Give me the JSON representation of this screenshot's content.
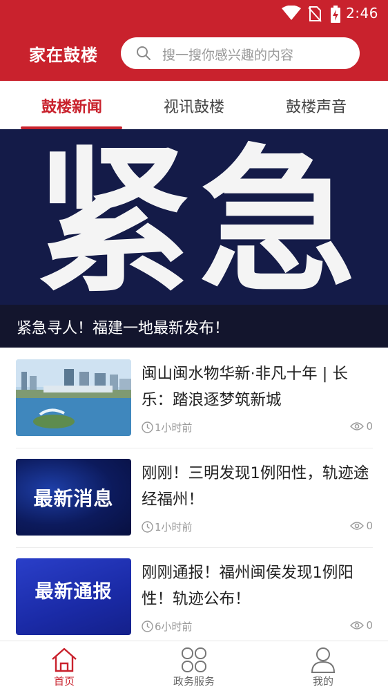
{
  "status_bar": {
    "time": "2:46",
    "icons": [
      "wifi-icon",
      "no-sim-icon",
      "battery-charging-icon"
    ]
  },
  "header": {
    "title": "家在鼓楼",
    "search_placeholder": "搜一搜你感兴趣的内容"
  },
  "tabs": [
    {
      "label": "鼓楼新闻",
      "active": true
    },
    {
      "label": "视讯鼓楼",
      "active": false
    },
    {
      "label": "鼓楼声音",
      "active": false
    }
  ],
  "banner": {
    "image_text": "紧急",
    "caption": "紧急寻人！福建一地最新发布！"
  },
  "news": [
    {
      "title": "闽山闽水物华新·非凡十年 | 长乐：踏浪逐梦筑新城",
      "time": "1小时前",
      "views": "0",
      "thumb_text": ""
    },
    {
      "title": "刚刚！三明发现1例阳性，轨迹途经福州！",
      "time": "1小时前",
      "views": "0",
      "thumb_text": "最新消息"
    },
    {
      "title": "刚刚通报！福州闽侯发现1例阳性！轨迹公布！",
      "time": "6小时前",
      "views": "0",
      "thumb_text": "最新通报"
    }
  ],
  "bottom_nav": [
    {
      "label": "首页",
      "icon": "home-icon",
      "active": true
    },
    {
      "label": "政务服务",
      "icon": "grid-icon",
      "active": false
    },
    {
      "label": "我的",
      "icon": "user-icon",
      "active": false
    }
  ],
  "colors": {
    "brand_red": "#c9222d",
    "banner_bg": "#141b48",
    "muted_text": "#999999"
  }
}
